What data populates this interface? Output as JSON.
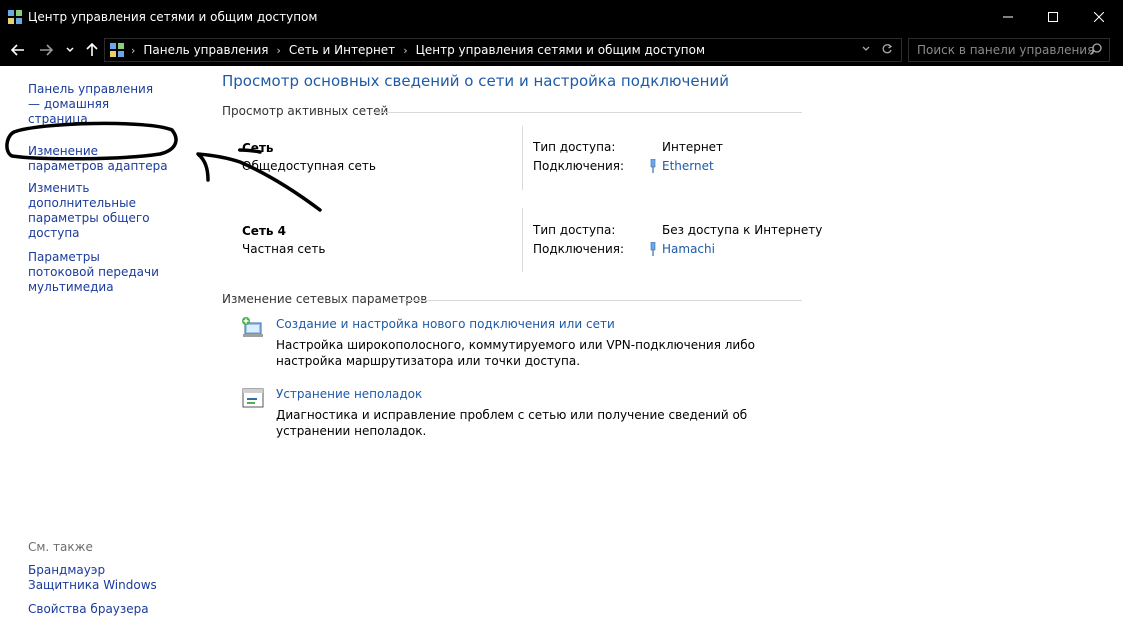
{
  "window": {
    "title": "Центр управления сетями и общим доступом",
    "controls": {
      "minimize_icon": "minimize-icon",
      "maximize_icon": "maximize-icon",
      "close_icon": "close-icon"
    }
  },
  "address_bar": {
    "breadcrumbs": [
      "Панель управления",
      "Сеть и Интернет",
      "Центр управления сетями и общим доступом"
    ]
  },
  "search": {
    "placeholder": "Поиск в панели управления"
  },
  "sidebar": {
    "links": [
      {
        "label": "Панель управления — домашняя страница"
      },
      {
        "label": "Изменение параметров адаптера"
      },
      {
        "label": "Изменить дополнительные параметры общего доступа"
      },
      {
        "label": "Параметры потоковой передачи мультимедиа"
      }
    ],
    "see_also_label": "См. также",
    "see_also": [
      {
        "label": "Брандмауэр Защитника Windows"
      },
      {
        "label": "Свойства браузера"
      }
    ]
  },
  "main": {
    "title": "Просмотр основных сведений о сети и настройка подключений",
    "active_networks_header": "Просмотр активных сетей",
    "networks": [
      {
        "name": "Сеть",
        "type": "Общедоступная сеть",
        "access_label": "Тип доступа:",
        "access_value": "Интернет",
        "connections_label": "Подключения:",
        "connection": "Ethernet"
      },
      {
        "name": "Сеть 4",
        "type": "Частная сеть",
        "access_label": "Тип доступа:",
        "access_value": "Без доступа к Интернету",
        "connections_label": "Подключения:",
        "connection": "Hamachi"
      }
    ],
    "change_settings_header": "Изменение сетевых параметров",
    "tasks": [
      {
        "link": "Создание и настройка нового подключения или сети",
        "description": "Настройка широкополосного, коммутируемого или VPN-подключения либо настройка маршрутизатора или точки доступа.",
        "icon": "new-connection-icon"
      },
      {
        "link": "Устранение неполадок",
        "description": "Диагностика и исправление проблем с сетью или получение сведений об устранении неполадок.",
        "icon": "troubleshoot-icon"
      }
    ]
  },
  "colors": {
    "link": "#1e5aa8",
    "sidebar_link": "#1a3b9c",
    "titlebar": "#000000",
    "annotation": "#000000"
  }
}
